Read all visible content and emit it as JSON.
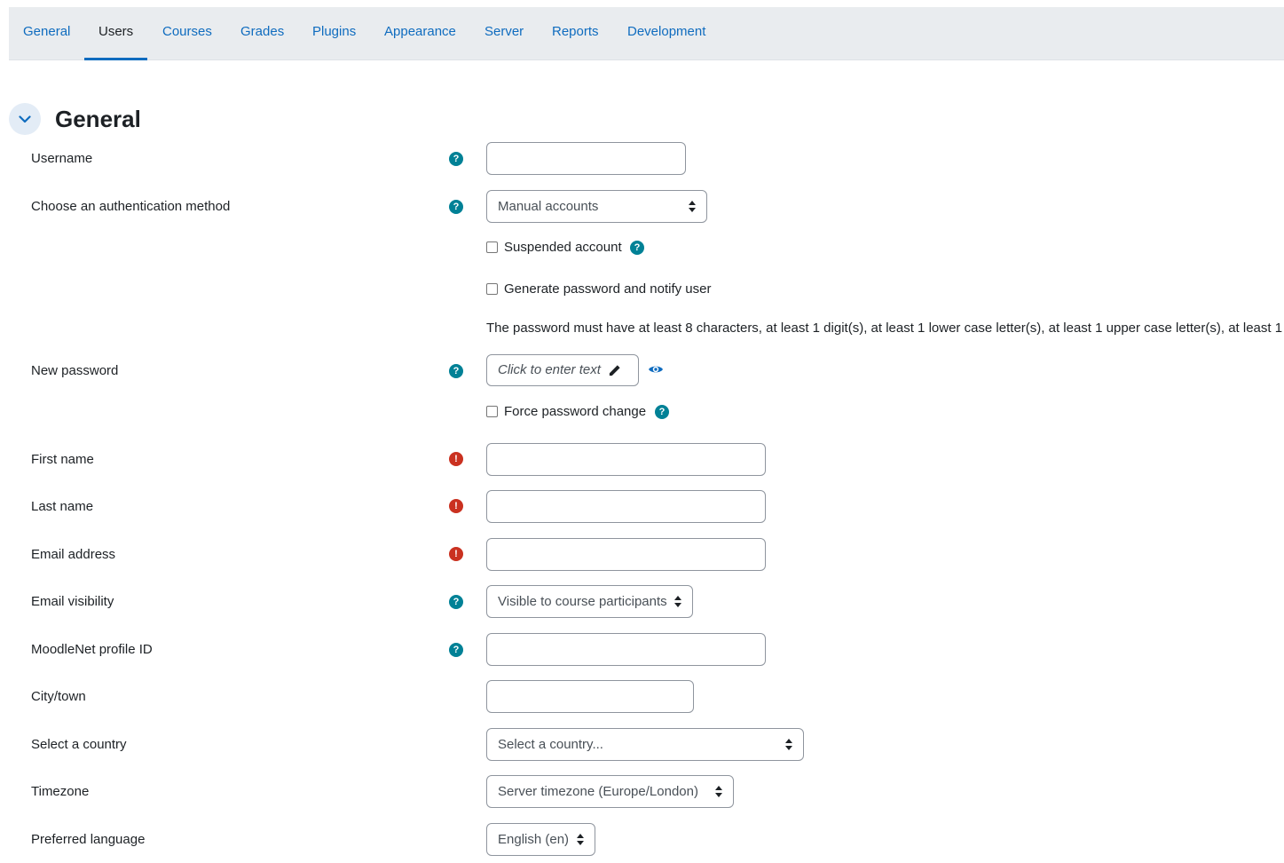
{
  "tabs": [
    {
      "label": "General"
    },
    {
      "label": "Users"
    },
    {
      "label": "Courses"
    },
    {
      "label": "Grades"
    },
    {
      "label": "Plugins"
    },
    {
      "label": "Appearance"
    },
    {
      "label": "Server"
    },
    {
      "label": "Reports"
    },
    {
      "label": "Development"
    }
  ],
  "active_tab": "Users",
  "section": {
    "title": "General",
    "icon": "chevron-down-icon"
  },
  "form": {
    "username": {
      "label": "Username",
      "value": ""
    },
    "auth": {
      "label": "Choose an authentication method",
      "value": "Manual accounts"
    },
    "suspended": {
      "label": "Suspended account",
      "checked": false
    },
    "generate_password": {
      "label": "Generate password and notify user",
      "checked": false
    },
    "password_rule": "The password must have at least 8 characters, at least 1 digit(s), at least 1 lower case letter(s), at least 1 upper case letter(s), at least 1",
    "new_password": {
      "label": "New password",
      "placeholder": "Click to enter text"
    },
    "force_change": {
      "label": "Force password change",
      "checked": false
    },
    "first_name": {
      "label": "First name",
      "value": ""
    },
    "last_name": {
      "label": "Last name",
      "value": ""
    },
    "email": {
      "label": "Email address",
      "value": ""
    },
    "email_visibility": {
      "label": "Email visibility",
      "value": "Visible to course participants"
    },
    "moodlenet": {
      "label": "MoodleNet profile ID",
      "value": ""
    },
    "city": {
      "label": "City/town",
      "value": ""
    },
    "country": {
      "label": "Select a country",
      "value": "Select a country..."
    },
    "timezone": {
      "label": "Timezone",
      "value": "Server timezone (Europe/London)"
    },
    "language": {
      "label": "Preferred language",
      "value": "English (en)"
    }
  },
  "icons": {
    "help": "question-circle-icon",
    "required": "exclamation-circle-icon",
    "reveal": "eye-icon",
    "edit": "pencil-icon"
  },
  "glyphs": {
    "help": "?",
    "required": "!"
  },
  "colors": {
    "link": "#0f6cbf",
    "help": "#008196",
    "required": "#ca3120",
    "tabbar": "#e9ecef"
  }
}
